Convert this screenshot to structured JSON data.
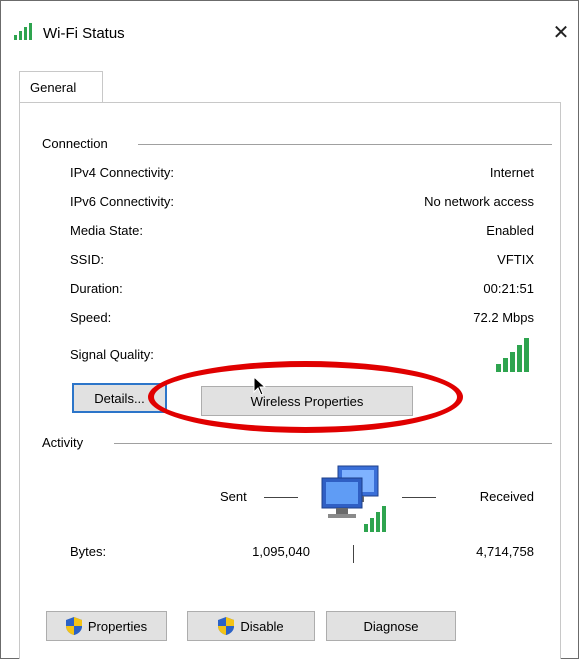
{
  "window": {
    "title": "Wi-Fi Status",
    "close_glyph": "✕"
  },
  "tabs": [
    {
      "label": "General",
      "selected": true
    }
  ],
  "connection": {
    "heading": "Connection",
    "rows": [
      {
        "label": "IPv4 Connectivity:",
        "value": "Internet"
      },
      {
        "label": "IPv6 Connectivity:",
        "value": "No network access"
      },
      {
        "label": "Media State:",
        "value": "Enabled"
      },
      {
        "label": "SSID:",
        "value": "VFTIX"
      },
      {
        "label": "Duration:",
        "value": "00:21:51"
      },
      {
        "label": "Speed:",
        "value": "72.2 Mbps"
      }
    ],
    "signal_quality_label": "Signal Quality:",
    "signal_bars_filled": 5,
    "signal_bars_total": 5
  },
  "buttons": {
    "details": "Details...",
    "wireless_properties": "Wireless Properties",
    "properties": "Properties",
    "disable": "Disable",
    "diagnose": "Diagnose"
  },
  "activity": {
    "heading": "Activity",
    "sent_label": "Sent",
    "received_label": "Received",
    "bytes_label": "Bytes:",
    "bytes_sent": "1,095,040",
    "bytes_received": "4,714,758"
  },
  "icons": {
    "title": "wifi-signal-icon",
    "signal": "signal-bars-icon",
    "activity": "network-computers-icon",
    "shield": "uac-shield-icon"
  },
  "colors": {
    "signal_green": "#2ea44f",
    "default_button_border": "#2c75c9",
    "highlight_oval": "#e00000"
  }
}
